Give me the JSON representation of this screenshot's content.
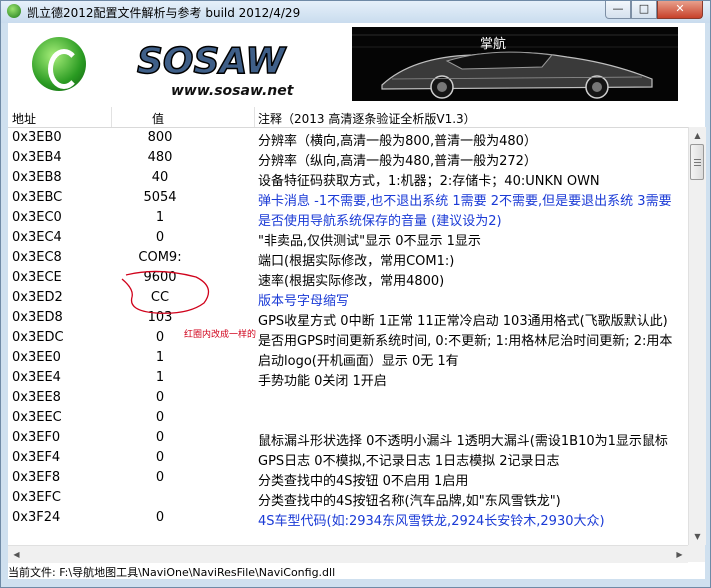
{
  "window": {
    "title": "凯立德2012配置文件解析与参考 build 2012/4/29",
    "min_symbol": "—",
    "max_symbol": "□",
    "close_symbol": "✕"
  },
  "banner": {
    "caption": "掌航",
    "sosaw_text": "SOSAW",
    "sosaw_url": "www.sosaw.net"
  },
  "table": {
    "columns": [
      "地址",
      "值",
      "注释（2013 高清逐条验证全析版V1.3）"
    ],
    "rows": [
      {
        "addr": "0x3EB0",
        "value": "800",
        "note": "分辨率（横向,高清一般为800,普清一般为480）",
        "color": "#000000"
      },
      {
        "addr": "0x3EB4",
        "value": "480",
        "note": "分辨率（纵向,高清一般为480,普清一般为272）",
        "color": "#000000"
      },
      {
        "addr": "0x3EB8",
        "value": "40",
        "note": "设备特征码获取方式，1:机器；2:存储卡；40:UNKN OWN",
        "color": "#000000"
      },
      {
        "addr": "0x3EBC",
        "value": "5054",
        "note": "弹卡消息 -1不需要,也不退出系统 1需要 2不需要,但是要退出系统 3需要",
        "color": "#1a3ad6"
      },
      {
        "addr": "0x3EC0",
        "value": "1",
        "note": "是否使用导航系统保存的音量 (建议设为2)",
        "color": "#1a3ad6"
      },
      {
        "addr": "0x3EC4",
        "value": "0",
        "note": "\"非卖品,仅供测试\"显示 0不显示 1显示",
        "color": "#000000"
      },
      {
        "addr": "0x3EC8",
        "value": "COM9:",
        "note": "端口(根据实际修改，常用COM1:)",
        "color": "#000000"
      },
      {
        "addr": "0x3ECE",
        "value": "9600",
        "note": "速率(根据实际修改，常用4800)",
        "color": "#000000"
      },
      {
        "addr": "0x3ED2",
        "value": "CC",
        "note": "版本号字母缩写",
        "color": "#1a3ad6"
      },
      {
        "addr": "0x3ED8",
        "value": "103",
        "note": "GPS收星方式 0中断 1正常 11正常冷启动 103通用格式(飞歌版默认此)",
        "color": "#000000"
      },
      {
        "addr": "0x3EDC",
        "value": "0",
        "note": "是否用GPS时间更新系统时间, 0:不更新; 1:用格林尼治时间更新; 2:用本",
        "color": "#000000"
      },
      {
        "addr": "0x3EE0",
        "value": "1",
        "note": "启动logo(开机画面）显示 0无 1有",
        "color": "#000000"
      },
      {
        "addr": "0x3EE4",
        "value": "1",
        "note": "手势功能 0关闭 1开启",
        "color": "#000000"
      },
      {
        "addr": "0x3EE8",
        "value": "0",
        "note": "",
        "color": "#000000"
      },
      {
        "addr": "0x3EEC",
        "value": "0",
        "note": "",
        "color": "#000000"
      },
      {
        "addr": "0x3EF0",
        "value": "0",
        "note": "鼠标漏斗形状选择 0不透明小漏斗 1透明大漏斗(需设1B10为1显示鼠标",
        "color": "#000000"
      },
      {
        "addr": "0x3EF4",
        "value": "0",
        "note": "GPS日志 0不模拟,不记录日志 1日志模拟 2记录日志",
        "color": "#000000"
      },
      {
        "addr": "0x3EF8",
        "value": "0",
        "note": "分类查找中的4S按钮 0不启用 1启用",
        "color": "#000000"
      },
      {
        "addr": "0x3EFC",
        "value": "",
        "note": "分类查找中的4S按钮名称(汽车品牌,如\"东风雪铁龙\")",
        "color": "#000000"
      },
      {
        "addr": "0x3F24",
        "value": "0",
        "note": "4S车型代码(如:2934东风雪铁龙,2924长安铃木,2930大众)",
        "color": "#1a3ad6"
      }
    ]
  },
  "annotation": {
    "text": "红圈内改成一样的",
    "color": "#d0021b"
  },
  "status": {
    "text": "当前文件: F:\\导航地图工具\\NaviOne\\NaviResFile\\NaviConfig.dll"
  }
}
